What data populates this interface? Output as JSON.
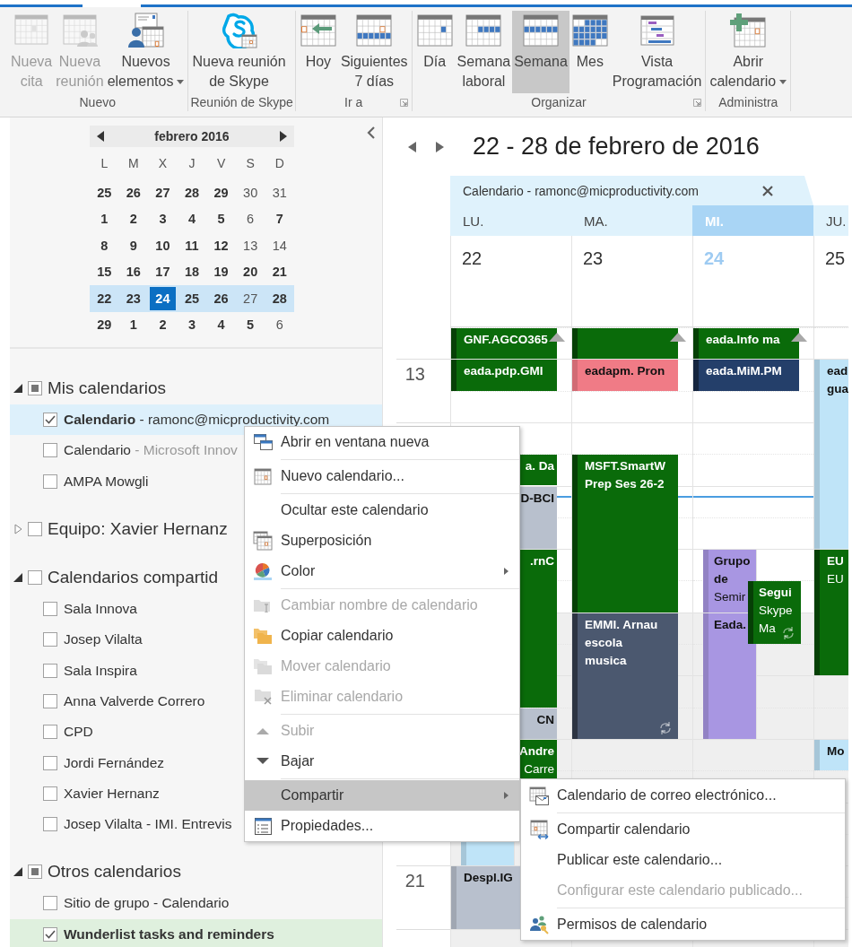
{
  "ribbon": {
    "groups": [
      {
        "label": "Nuevo",
        "launcher": false,
        "buttons": [
          {
            "label": "Nueva\ncita",
            "disabled": true,
            "dropdown": false,
            "selected": false
          },
          {
            "label": "Nueva\nreunión",
            "disabled": true,
            "dropdown": false,
            "selected": false
          },
          {
            "label": "Nuevos\nelementos",
            "disabled": false,
            "dropdown": true,
            "selected": false
          }
        ]
      },
      {
        "label": "Reunión de Skype",
        "launcher": false,
        "buttons": [
          {
            "label": "Nueva reunión\nde Skype",
            "disabled": false,
            "dropdown": false,
            "selected": false
          }
        ]
      },
      {
        "label": "Ir a",
        "launcher": true,
        "buttons": [
          {
            "label": "Hoy",
            "disabled": false,
            "dropdown": false,
            "selected": false
          },
          {
            "label": "Siguientes\n7 días",
            "disabled": false,
            "dropdown": false,
            "selected": false
          }
        ]
      },
      {
        "label": "Organizar",
        "launcher": true,
        "buttons": [
          {
            "label": "Día",
            "disabled": false,
            "dropdown": false,
            "selected": false
          },
          {
            "label": "Semana\nlaboral",
            "disabled": false,
            "dropdown": false,
            "selected": false
          },
          {
            "label": "Semana",
            "disabled": false,
            "dropdown": false,
            "selected": true
          },
          {
            "label": "Mes",
            "disabled": false,
            "dropdown": false,
            "selected": false
          },
          {
            "label": "Vista\nProgramación",
            "disabled": false,
            "dropdown": false,
            "selected": false
          }
        ]
      },
      {
        "label": "Administra",
        "launcher": false,
        "buttons": [
          {
            "label": "Abrir\ncalendario",
            "disabled": false,
            "dropdown": true,
            "selected": false
          }
        ]
      }
    ]
  },
  "mini_calendar": {
    "title": "febrero 2016",
    "weekdays": [
      "L",
      "M",
      "X",
      "J",
      "V",
      "S",
      "D"
    ],
    "weeks": [
      [
        {
          "label": "25",
          "bold": true,
          "selected": false,
          "today": false
        },
        {
          "label": "26",
          "bold": true,
          "selected": false,
          "today": false
        },
        {
          "label": "27",
          "bold": true,
          "selected": false,
          "today": false
        },
        {
          "label": "28",
          "bold": true,
          "selected": false,
          "today": false
        },
        {
          "label": "29",
          "bold": true,
          "selected": false,
          "today": false
        },
        {
          "label": "30",
          "bold": false,
          "selected": false,
          "today": false
        },
        {
          "label": "31",
          "bold": false,
          "selected": false,
          "today": false
        }
      ],
      [
        {
          "label": "1",
          "bold": true,
          "selected": false,
          "today": false
        },
        {
          "label": "2",
          "bold": true,
          "selected": false,
          "today": false
        },
        {
          "label": "3",
          "bold": true,
          "selected": false,
          "today": false
        },
        {
          "label": "4",
          "bold": true,
          "selected": false,
          "today": false
        },
        {
          "label": "5",
          "bold": true,
          "selected": false,
          "today": false
        },
        {
          "label": "6",
          "bold": false,
          "selected": false,
          "today": false
        },
        {
          "label": "7",
          "bold": true,
          "selected": false,
          "today": false
        }
      ],
      [
        {
          "label": "8",
          "bold": true,
          "selected": false,
          "today": false
        },
        {
          "label": "9",
          "bold": true,
          "selected": false,
          "today": false
        },
        {
          "label": "10",
          "bold": true,
          "selected": false,
          "today": false
        },
        {
          "label": "11",
          "bold": true,
          "selected": false,
          "today": false
        },
        {
          "label": "12",
          "bold": true,
          "selected": false,
          "today": false
        },
        {
          "label": "13",
          "bold": false,
          "selected": false,
          "today": false
        },
        {
          "label": "14",
          "bold": false,
          "selected": false,
          "today": false
        }
      ],
      [
        {
          "label": "15",
          "bold": true,
          "selected": false,
          "today": false
        },
        {
          "label": "16",
          "bold": true,
          "selected": false,
          "today": false
        },
        {
          "label": "17",
          "bold": true,
          "selected": false,
          "today": false
        },
        {
          "label": "18",
          "bold": true,
          "selected": false,
          "today": false
        },
        {
          "label": "19",
          "bold": true,
          "selected": false,
          "today": false
        },
        {
          "label": "20",
          "bold": true,
          "selected": false,
          "today": false
        },
        {
          "label": "21",
          "bold": true,
          "selected": false,
          "today": false
        }
      ],
      [
        {
          "label": "22",
          "bold": true,
          "selected": true,
          "today": false
        },
        {
          "label": "23",
          "bold": true,
          "selected": true,
          "today": false
        },
        {
          "label": "24",
          "bold": true,
          "selected": true,
          "today": true
        },
        {
          "label": "25",
          "bold": true,
          "selected": true,
          "today": false
        },
        {
          "label": "26",
          "bold": true,
          "selected": true,
          "today": false
        },
        {
          "label": "27",
          "bold": false,
          "selected": true,
          "today": false
        },
        {
          "label": "28",
          "bold": true,
          "selected": true,
          "today": false
        }
      ],
      [
        {
          "label": "29",
          "bold": true,
          "selected": false,
          "today": false
        },
        {
          "label": "1",
          "bold": true,
          "selected": false,
          "today": false
        },
        {
          "label": "2",
          "bold": true,
          "selected": false,
          "today": false
        },
        {
          "label": "3",
          "bold": true,
          "selected": false,
          "today": false
        },
        {
          "label": "4",
          "bold": true,
          "selected": false,
          "today": false
        },
        {
          "label": "5",
          "bold": true,
          "selected": false,
          "today": false
        },
        {
          "label": "6",
          "bold": false,
          "selected": false,
          "today": false
        }
      ]
    ]
  },
  "calendar_groups": [
    {
      "label": "Mis calendarios",
      "expanded": true,
      "checked": false,
      "partial": true,
      "items": [
        {
          "name": "Calendario",
          "detail": "- ramonc@micproductivity.com",
          "checked": true,
          "color": "#ddf0fb"
        },
        {
          "name": "Calendario",
          "detail": "- Microsoft Innov",
          "checked": false
        },
        {
          "name": "AMPA Mowgli",
          "checked": false
        }
      ]
    },
    {
      "label": "Equipo: Xavier Hernanz",
      "expanded": false,
      "checked": false,
      "partial": false
    },
    {
      "label": "Calendarios compartid",
      "expanded": true,
      "checked": false,
      "partial": false,
      "items": [
        {
          "name": "Sala Innova",
          "checked": false
        },
        {
          "name": "Josep Vilalta",
          "checked": false
        },
        {
          "name": "Sala Inspira",
          "checked": false
        },
        {
          "name": "Anna Valverde Correro",
          "checked": false
        },
        {
          "name": "CPD",
          "checked": false
        },
        {
          "name": "Jordi Fernández",
          "checked": false
        },
        {
          "name": "Xavier Hernanz",
          "checked": false
        },
        {
          "name": "Josep Vilalta - IMI. Entrevis",
          "checked": false
        }
      ]
    },
    {
      "label": "Otros calendarios",
      "expanded": true,
      "checked": false,
      "partial": true,
      "items": [
        {
          "name": "Sitio de grupo - Calendario",
          "checked": false
        },
        {
          "name": "Wunderlist tasks and reminders",
          "checked": true,
          "color": "#dff0de"
        }
      ]
    }
  ],
  "calendar_view": {
    "title": "22 - 28 de febrero de 2016",
    "tab": {
      "label": "Calendario - ramonc@micproductivity.com"
    },
    "hour_labels": [
      "13",
      "21"
    ],
    "days": [
      {
        "weekday": "LU.",
        "date": "22",
        "today": false,
        "events": [
          {
            "title": "GNF.AGCO365",
            "color": "#0a6b0a",
            "continues_above": true
          },
          {
            "title": "eada.pdp.GMI",
            "color": "#0a6b0a"
          },
          {
            "title": "a. Da",
            "color": "#0a6b0a",
            "partly_hidden": true
          },
          {
            "title": "D-BCI",
            "color": "#b8c0cd",
            "partly_hidden": true
          },
          {
            "title": ".rnC",
            "color": "#0a6b0a",
            "partly_hidden": true
          },
          {
            "title": "CN",
            "color": "#b8c0cd",
            "partly_hidden": true
          },
          {
            "title": "Andre",
            "detail": "Carre",
            "color": "#0a6b0a",
            "partly_hidden": true
          },
          {
            "color": "#bfe4f8"
          },
          {
            "title": "Despl.IG",
            "color": "#b8c0cd"
          }
        ]
      },
      {
        "weekday": "MA.",
        "date": "23",
        "today": false,
        "events": [
          {
            "color": "#0a6b0a",
            "continues_above": true
          },
          {
            "title": "eadapm. Pron",
            "color": "#f07b86"
          },
          {
            "title": "MSFT.SmartW\nPrep Ses 26-2",
            "color": "#0a6b0a"
          },
          {
            "title": "EMMI. Arnau\nescola\nmusica",
            "color": "#4b586f",
            "recurring": true
          }
        ]
      },
      {
        "weekday": "MI.",
        "date": "24",
        "today": true,
        "events": [
          {
            "title": "eada.Info ma",
            "color": "#0a6b0a",
            "continues_above": true
          },
          {
            "title": "eada.MiM.PM",
            "color": "#243f6a"
          },
          {
            "title": "Grupo\nde",
            "detail": "Semir",
            "color": "#a896e2"
          },
          {
            "title": "Eada.",
            "color": "#a896e2"
          },
          {
            "title": "Segui",
            "detail": "Skype\nMa",
            "color": "#0a6b0a",
            "recurring": true
          }
        ]
      },
      {
        "weekday": "JU.",
        "date": "25",
        "today": false,
        "events": [
          {
            "title": "ead\ngua",
            "color": "#bfe4f8"
          },
          {
            "title": "EU",
            "detail": "EU",
            "color": "#0a6b0a"
          },
          {
            "title": "Mo",
            "color": "#bfe4f8"
          }
        ]
      }
    ]
  },
  "context_menu": [
    {
      "kind": "item",
      "label": "Abrir en ventana nueva",
      "disabled": false,
      "submenu": false,
      "selected": false
    },
    {
      "kind": "separator"
    },
    {
      "kind": "item",
      "label": "Nuevo calendario...",
      "disabled": false,
      "submenu": false,
      "selected": false
    },
    {
      "kind": "separator"
    },
    {
      "kind": "item",
      "label": "Ocultar este calendario",
      "disabled": false,
      "submenu": false,
      "selected": false
    },
    {
      "kind": "item",
      "label": "Superposición",
      "disabled": false,
      "submenu": false,
      "selected": false
    },
    {
      "kind": "item",
      "label": "Color",
      "disabled": false,
      "submenu": true,
      "selected": false
    },
    {
      "kind": "separator"
    },
    {
      "kind": "item",
      "label": "Cambiar nombre de calendario",
      "disabled": true,
      "submenu": false,
      "selected": false
    },
    {
      "kind": "item",
      "label": "Copiar calendario",
      "disabled": false,
      "submenu": false,
      "selected": false
    },
    {
      "kind": "item",
      "label": "Mover calendario",
      "disabled": true,
      "submenu": false,
      "selected": false
    },
    {
      "kind": "item",
      "label": "Eliminar calendario",
      "disabled": true,
      "submenu": false,
      "selected": false
    },
    {
      "kind": "separator"
    },
    {
      "kind": "item",
      "label": "Subir",
      "disabled": true,
      "submenu": false,
      "selected": false
    },
    {
      "kind": "item",
      "label": "Bajar",
      "disabled": false,
      "submenu": false,
      "selected": false
    },
    {
      "kind": "separator"
    },
    {
      "kind": "item",
      "label": "Compartir",
      "disabled": false,
      "submenu": true,
      "selected": true
    },
    {
      "kind": "item",
      "label": "Propiedades...",
      "disabled": false,
      "submenu": false,
      "selected": false
    }
  ],
  "submenu": [
    {
      "kind": "item",
      "label": "Calendario de correo electrónico...",
      "disabled": false,
      "submenu": false,
      "selected": false
    },
    {
      "kind": "separator"
    },
    {
      "kind": "item",
      "label": "Compartir calendario",
      "disabled": false,
      "submenu": false,
      "selected": false
    },
    {
      "kind": "item",
      "label": "Publicar este calendario...",
      "disabled": false,
      "submenu": false,
      "selected": false
    },
    {
      "kind": "item",
      "label": "Configurar este calendario publicado...",
      "disabled": true,
      "submenu": false,
      "selected": false
    },
    {
      "kind": "separator"
    },
    {
      "kind": "item",
      "label": "Permisos de calendario",
      "disabled": false,
      "submenu": false,
      "selected": false
    }
  ]
}
